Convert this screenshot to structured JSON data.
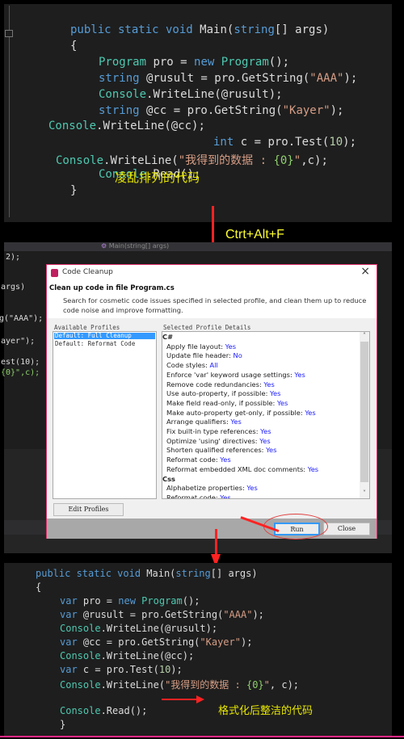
{
  "top_panel": {
    "note": "凌乱排列的代码",
    "lines": [
      [
        [
          "kw",
          "public static void "
        ],
        [
          "pl",
          "Main("
        ],
        [
          "kw",
          "string"
        ],
        [
          "pl",
          "[] args)"
        ]
      ],
      [
        [
          "pl",
          "{"
        ]
      ],
      [
        [
          "ty",
          "Program"
        ],
        [
          "pl",
          " pro = "
        ],
        [
          "kw",
          "new "
        ],
        [
          "ty",
          "Program"
        ],
        [
          "pl",
          "();"
        ]
      ],
      [
        [
          "kw",
          "string"
        ],
        [
          "pl",
          " @rusult = pro.GetString("
        ],
        [
          "st",
          "\"AAA\""
        ],
        [
          "pl",
          ");"
        ]
      ],
      [
        [
          "ty",
          "Console"
        ],
        [
          "pl",
          ".WriteLine(@rusult);"
        ]
      ],
      [
        [
          "kw",
          "string"
        ],
        [
          "pl",
          " @cc = pro.GetString("
        ],
        [
          "st",
          "\"Kayer\""
        ],
        [
          "pl",
          ");"
        ]
      ],
      [
        [
          "ty",
          "Console"
        ],
        [
          "pl",
          ".WriteLine(@cc);"
        ]
      ],
      [
        [
          "kw",
          "int"
        ],
        [
          "pl",
          " c = pro.Test("
        ],
        [
          "nm",
          "10"
        ],
        [
          "pl",
          ");"
        ]
      ],
      [
        [
          "ty",
          "Console"
        ],
        [
          "pl",
          ".WriteLine("
        ],
        [
          "st",
          "\"我得到的数据 : "
        ],
        [
          "fm",
          "{0}"
        ],
        [
          "st",
          "\""
        ],
        [
          "pl",
          ",c);"
        ]
      ],
      [
        [
          "ty",
          "Console"
        ],
        [
          "pl",
          ".Read();"
        ]
      ],
      [
        [
          "pl",
          "}"
        ]
      ]
    ]
  },
  "shortcut": "Ctrt+Alt+F",
  "ide_background": {
    "breadcrumb": "Main(string[] args)",
    "code_fragments": [
      "2);",
      "args)",
      "g(\"AAA\");",
      "ayer\");",
      "est(10);",
      "{0}\",c);"
    ]
  },
  "dialog": {
    "title": "Code Cleanup",
    "heading": "Clean up code in file Program.cs",
    "description": "Search for cosmetic code issues specified in selected profile, and clean them up to reduce code noise and improve formatting.",
    "profiles_label": "Available Profiles",
    "profiles": [
      "Default: Full Cleanup",
      "Default: Reformat Code"
    ],
    "selected_profile": "Default: Full Cleanup",
    "details_label": "Selected Profile Details",
    "details": [
      {
        "header": "C#"
      },
      {
        "label": "Apply file layout:",
        "value": "Yes"
      },
      {
        "label": "Update file header:",
        "value": "No"
      },
      {
        "label": "Code styles:",
        "value": "All"
      },
      {
        "label": "Enforce 'var' keyword usage settings:",
        "value": "Yes"
      },
      {
        "label": "Remove code redundancies:",
        "value": "Yes"
      },
      {
        "label": "Use auto-property, if possible:",
        "value": "Yes"
      },
      {
        "label": "Make field read-only, if possible:",
        "value": "Yes"
      },
      {
        "label": "Make auto-property get-only, if possible:",
        "value": "Yes"
      },
      {
        "label": "Arrange qualifiers:",
        "value": "Yes"
      },
      {
        "label": "Fix built-in type references:",
        "value": "Yes"
      },
      {
        "label": "Optimize 'using' directives:",
        "value": "Yes"
      },
      {
        "label": "Shorten qualified references:",
        "value": "Yes"
      },
      {
        "label": "Reformat code:",
        "value": "Yes"
      },
      {
        "label": "Reformat embedded XML doc comments:",
        "value": "Yes"
      },
      {
        "header": "Css"
      },
      {
        "label": "Alphabetize properties:",
        "value": "Yes"
      },
      {
        "label": "Reformat code:",
        "value": "Yes"
      }
    ],
    "edit_profiles": "Edit Profiles",
    "run": "Run",
    "close": "Close",
    "close_icon": "×"
  },
  "bottom_panel": {
    "note": "格式化后整洁的代码",
    "lines": [
      [
        [
          "kw",
          "public static void "
        ],
        [
          "pl",
          "Main("
        ],
        [
          "kw",
          "string"
        ],
        [
          "pl",
          "[] args)"
        ]
      ],
      [
        [
          "pl",
          "{"
        ]
      ],
      [
        [
          "kw",
          "var"
        ],
        [
          "pl",
          " pro = "
        ],
        [
          "kw",
          "new "
        ],
        [
          "ty",
          "Program"
        ],
        [
          "pl",
          "();"
        ]
      ],
      [
        [
          "kw",
          "var"
        ],
        [
          "pl",
          " @rusult = pro.GetString("
        ],
        [
          "st",
          "\"AAA\""
        ],
        [
          "pl",
          ");"
        ]
      ],
      [
        [
          "ty",
          "Console"
        ],
        [
          "pl",
          ".WriteLine(@rusult);"
        ]
      ],
      [
        [
          "kw",
          "var"
        ],
        [
          "pl",
          " @cc = pro.GetString("
        ],
        [
          "st",
          "\"Kayer\""
        ],
        [
          "pl",
          ");"
        ]
      ],
      [
        [
          "ty",
          "Console"
        ],
        [
          "pl",
          ".WriteLine(@cc);"
        ]
      ],
      [
        [
          "kw",
          "var"
        ],
        [
          "pl",
          " c = pro.Test("
        ],
        [
          "nm",
          "10"
        ],
        [
          "pl",
          ");"
        ]
      ],
      [
        [
          "ty",
          "Console"
        ],
        [
          "pl",
          ".WriteLine("
        ],
        [
          "st",
          "\"我得到的数据 : "
        ],
        [
          "fm",
          "{0}"
        ],
        [
          "st",
          "\""
        ],
        [
          "pl",
          ", c);"
        ]
      ],
      [],
      [
        [
          "ty",
          "Console"
        ],
        [
          "pl",
          ".Read();"
        ]
      ],
      [
        [
          "pl",
          "}"
        ]
      ]
    ]
  },
  "colors": {
    "keyword": "#569cd6",
    "type": "#4ec9b0",
    "string": "#d69d85",
    "number": "#b5cea8",
    "annotation": "#e6e600",
    "arrow": "#ff2222",
    "selection": "#3399ff",
    "detail_value": "#1a1aff"
  }
}
